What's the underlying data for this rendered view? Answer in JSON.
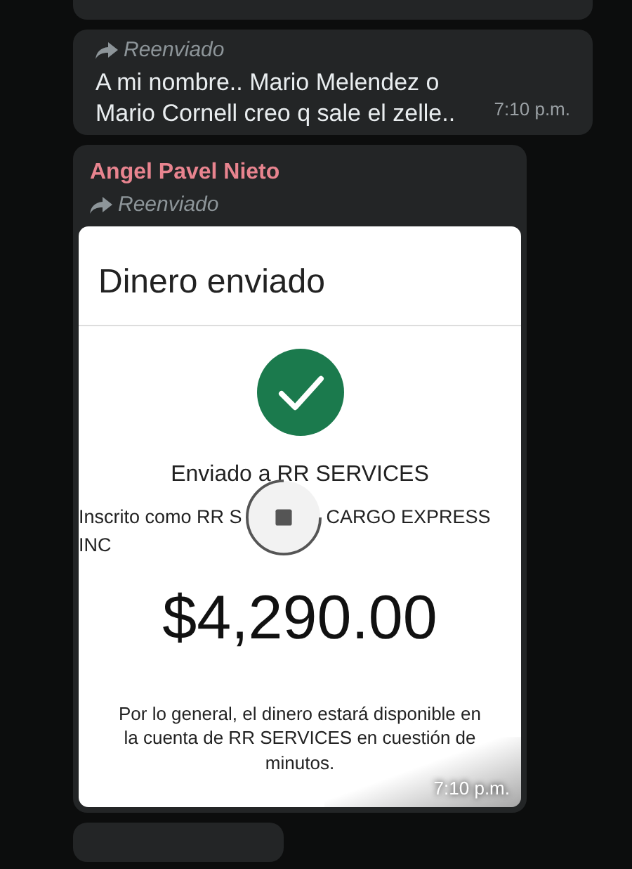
{
  "messages": [
    {
      "kind": "partial"
    },
    {
      "kind": "text",
      "forwarded_label": "Reenviado",
      "text": "A mi nombre.. Mario Melendez o Mario Cornell creo q sale el zelle..",
      "time": "7:10 p.m."
    },
    {
      "kind": "image",
      "sender": "Angel Pavel Nieto",
      "forwarded_label": "Reenviado",
      "time": "7:10 p.m.",
      "receipt": {
        "title": "Dinero enviado",
        "sent_to": "Enviado a RR SERVICES",
        "registered_left": "Inscrito como RR S",
        "registered_right": "CARGO EXPRESS",
        "registered_line2": "INC",
        "amount": "$4,290.00",
        "note": "Por lo general, el dinero estará disponible en la cuenta de RR SERVICES en cuestión de minutos."
      }
    },
    {
      "kind": "partial"
    }
  ]
}
